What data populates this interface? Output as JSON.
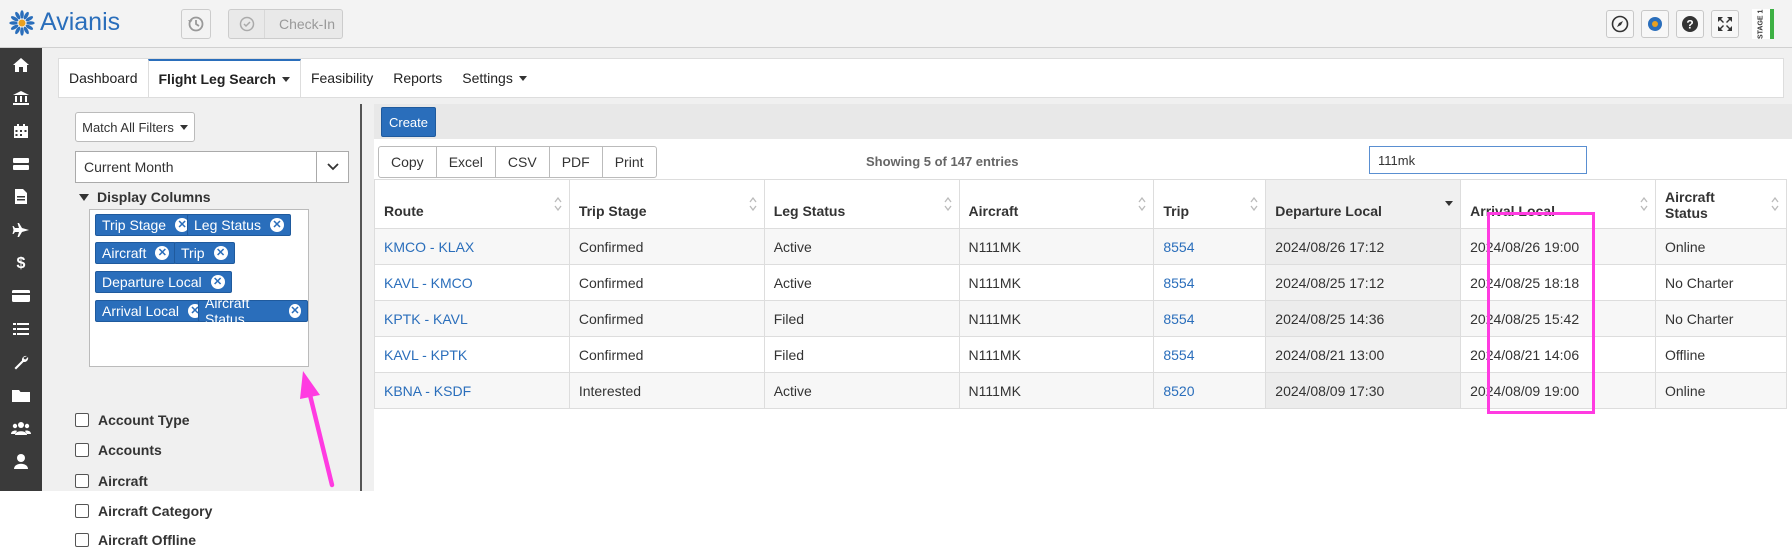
{
  "app": {
    "brand": "Avianis",
    "checkin_label": "Check-In",
    "stage_label": "STAGE 1"
  },
  "nav": {
    "tabs": [
      {
        "label": "Dashboard"
      },
      {
        "label": "Flight Leg Search"
      },
      {
        "label": "Feasibility"
      },
      {
        "label": "Reports"
      },
      {
        "label": "Settings"
      }
    ]
  },
  "filters": {
    "match_label": "Match All Filters",
    "period_value": "Current Month",
    "display_columns_label": "Display Columns",
    "tags": [
      "Trip Stage",
      "Leg Status",
      "Aircraft",
      "Trip",
      "Departure Local",
      "Arrival Local",
      "Aircraft Status"
    ],
    "items": [
      "Account Type",
      "Accounts",
      "Aircraft",
      "Aircraft Category",
      "Aircraft Offline"
    ]
  },
  "results": {
    "create_label": "Create",
    "export_buttons": [
      "Copy",
      "Excel",
      "CSV",
      "PDF",
      "Print"
    ],
    "showing_text": "Showing 5 of 147 entries",
    "search_value": "111mk",
    "headers": [
      "Route",
      "Trip Stage",
      "Leg Status",
      "Aircraft",
      "Trip",
      "Departure Local",
      "Arrival Local",
      "Aircraft Status"
    ],
    "aircraft_status_header_line1": "Aircraft",
    "aircraft_status_header_line2": "Status",
    "rows": [
      [
        "KMCO - KLAX",
        "Confirmed",
        "Active",
        "N111MK",
        "8554",
        "2024/08/26 17:12",
        "2024/08/26 19:00",
        "Online"
      ],
      [
        "KAVL - KMCO",
        "Confirmed",
        "Active",
        "N111MK",
        "8554",
        "2024/08/25 17:12",
        "2024/08/25 18:18",
        "No Charter"
      ],
      [
        "KPTK - KAVL",
        "Confirmed",
        "Filed",
        "N111MK",
        "8554",
        "2024/08/25 14:36",
        "2024/08/25 15:42",
        "No Charter"
      ],
      [
        "KAVL - KPTK",
        "Confirmed",
        "Filed",
        "N111MK",
        "8554",
        "2024/08/21 13:00",
        "2024/08/21 14:06",
        "Offline"
      ],
      [
        "KBNA - KSDF",
        "Interested",
        "Active",
        "N111MK",
        "8520",
        "2024/08/09 17:30",
        "2024/08/09 19:00",
        "Online"
      ]
    ]
  },
  "colors": {
    "brand_blue": "#2a6ebb",
    "highlight_magenta": "#ff3be1",
    "rail_dark": "#3a3a3a"
  }
}
